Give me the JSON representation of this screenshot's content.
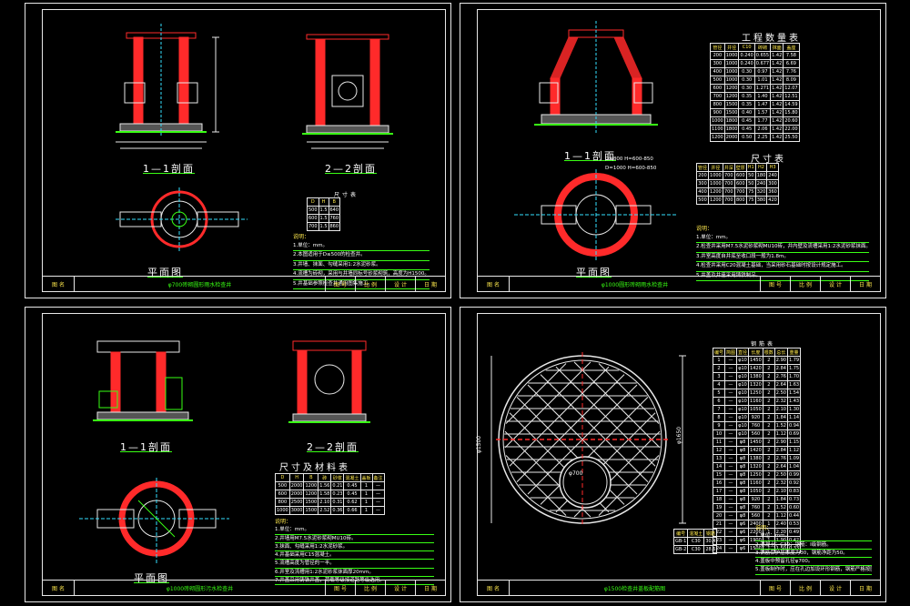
{
  "colors": {
    "background": "#000000",
    "line": "#e8e8e8",
    "red": "#ff2a2a",
    "green": "#39ff14",
    "yellow": "#ffe94d",
    "cyan": "#33e0ff"
  },
  "sheet1": {
    "section_a": "1—1剖面",
    "section_b": "2—2剖面",
    "plan": "平面图",
    "table_title": "尺寸表",
    "table_rows": [
      [
        "D",
        "H",
        "B"
      ],
      [
        "500",
        "1.5",
        "640"
      ],
      [
        "600",
        "1.5",
        "760"
      ],
      [
        "700",
        "1.5",
        "860"
      ]
    ],
    "notes": [
      "说明：",
      "1.单位：mm。",
      "2.本图适用于D≤500的检查井。",
      "3.井墙、抹面、勾缝采用1:2水泥砂浆。",
      "4.流槽为砖砌，采用与井墙同标号砂浆砌筑，高度为H1500。",
      "5.井基础参照检查井通用图集施工。"
    ],
    "title_block": [
      "图 名",
      "φ700砖砌圆形雨水检查井",
      "图 号",
      "比 例",
      "设 计",
      "日 期"
    ]
  },
  "sheet2": {
    "table1_title": "工程数量表",
    "table1_rows": [
      [
        "管径",
        "井径",
        "C10",
        "砖砌",
        "抹面",
        "盖座"
      ],
      [
        "200",
        "1000",
        "0.240",
        "0.655",
        "1.42",
        "7.58"
      ],
      [
        "300",
        "1000",
        "0.240",
        "0.677",
        "1.42",
        "6.69"
      ],
      [
        "400",
        "1000",
        "0.30",
        "0.97",
        "1.42",
        "7.76"
      ],
      [
        "500",
        "1000",
        "0.30",
        "1.01",
        "1.42",
        "8.09"
      ],
      [
        "600",
        "1200",
        "0.30",
        "1.271",
        "1.42",
        "12.07"
      ],
      [
        "700",
        "1200",
        "0.35",
        "1.40",
        "1.42",
        "12.51"
      ],
      [
        "800",
        "1500",
        "0.35",
        "1.47",
        "1.42",
        "14.59"
      ],
      [
        "900",
        "1500",
        "0.40",
        "1.57",
        "1.42",
        "15.80"
      ],
      [
        "1000",
        "1800",
        "0.45",
        "1.77",
        "1.42",
        "20.60"
      ],
      [
        "1100",
        "1800",
        "0.45",
        "2.06",
        "1.42",
        "22.00"
      ],
      [
        "1200",
        "2000",
        "0.50",
        "2.25",
        "1.42",
        "25.50"
      ]
    ],
    "table2_title": "尺寸表",
    "table2_rows": [
      [
        "管径",
        "井径",
        "井深",
        "壁厚",
        "H1",
        "H2",
        "H3"
      ],
      [
        "200",
        "1000",
        "700",
        "600",
        "50",
        "180",
        "240"
      ],
      [
        "300",
        "1000",
        "700",
        "600",
        "50",
        "240",
        "300"
      ],
      [
        "400",
        "1200",
        "700",
        "700",
        "75",
        "320",
        "360"
      ],
      [
        "500",
        "1200",
        "700",
        "800",
        "75",
        "380",
        "420"
      ]
    ],
    "section": "1—1剖面",
    "plan": "平面图",
    "note_right": [
      "D=800 H=600-850",
      "D=1000 H=600-850"
    ],
    "notes": [
      "说明：",
      "1.单位：mm。",
      "2.检查井采用M7.5水泥砂浆砌MU10砖，井内壁及流槽采用1:2水泥砂浆抹面。",
      "3.井室高度自井底至收口段一般为1.8m。",
      "4.检查井采用C20混凝土基础，当采用砂石基础时按设计规定施工。",
      "5.井盖及井座采用铸铁制品。"
    ],
    "title_block": [
      "图 名",
      "φ1000圆形砖砌雨水检查井",
      "图 号",
      "比 例",
      "设 计",
      "日 期"
    ]
  },
  "sheet3": {
    "section_a": "1—1剖面",
    "section_b": "2—2剖面",
    "plan": "平面图",
    "table_title": "尺寸及材料表",
    "table_rows": [
      [
        "D",
        "H",
        "B",
        "砖",
        "砂浆",
        "混凝土",
        "盖板",
        "备注"
      ],
      [
        "500",
        "2000",
        "1200",
        "1.56",
        "0.21",
        "0.45",
        "1",
        "—"
      ],
      [
        "600",
        "2000",
        "1200",
        "1.58",
        "0.23",
        "0.45",
        "1",
        "—"
      ],
      [
        "800",
        "2500",
        "1500",
        "2.10",
        "0.31",
        "0.62",
        "1",
        "—"
      ],
      [
        "1000",
        "3000",
        "1500",
        "2.52",
        "0.36",
        "0.66",
        "1",
        "—"
      ]
    ],
    "notes": [
      "说明：",
      "1.单位：mm。",
      "2.井墙用M7.5水泥砂浆砌MU10砖。",
      "3.抹面、勾缝采用1:2水泥砂浆。",
      "4.井基础采用C15混凝土。",
      "5.流槽高度为管径的一半。",
      "6.井室及流槽用1:2水泥砂浆抹面厚20mm。",
      "7.井盖采用铸铁井盖，荷载等级按道路等级选用。"
    ],
    "title_block": [
      "图 名",
      "φ1000砖砌圆形污水检查井",
      "图 号",
      "比 例",
      "设 计",
      "日 期"
    ]
  },
  "sheet4": {
    "dim_left": "φ1500",
    "dim_right": "φ1650",
    "dim_hole": "φ700",
    "table_title": "钢筋表",
    "table_header": [
      "编号",
      "简图",
      "直径",
      "长度",
      "根数",
      "总长",
      "重量"
    ],
    "table_rows": [
      [
        "1",
        "—",
        "φ10",
        "1450",
        "2",
        "2.90",
        "1.79"
      ],
      [
        "2",
        "—",
        "φ10",
        "1420",
        "2",
        "2.84",
        "1.75"
      ],
      [
        "3",
        "—",
        "φ10",
        "1380",
        "2",
        "2.76",
        "1.70"
      ],
      [
        "4",
        "—",
        "φ10",
        "1320",
        "2",
        "2.64",
        "1.63"
      ],
      [
        "5",
        "—",
        "φ10",
        "1250",
        "2",
        "2.50",
        "1.54"
      ],
      [
        "6",
        "—",
        "φ10",
        "1160",
        "2",
        "2.32",
        "1.43"
      ],
      [
        "7",
        "—",
        "φ10",
        "1050",
        "2",
        "2.10",
        "1.30"
      ],
      [
        "8",
        "—",
        "φ10",
        "920",
        "2",
        "1.84",
        "1.14"
      ],
      [
        "9",
        "—",
        "φ10",
        "760",
        "2",
        "1.52",
        "0.94"
      ],
      [
        "10",
        "—",
        "φ10",
        "560",
        "2",
        "1.12",
        "0.69"
      ],
      [
        "11",
        "—",
        "φ8",
        "1450",
        "2",
        "2.90",
        "1.15"
      ],
      [
        "12",
        "—",
        "φ8",
        "1420",
        "2",
        "2.84",
        "1.12"
      ],
      [
        "13",
        "—",
        "φ8",
        "1380",
        "2",
        "2.76",
        "1.09"
      ],
      [
        "14",
        "—",
        "φ8",
        "1320",
        "2",
        "2.64",
        "1.04"
      ],
      [
        "15",
        "—",
        "φ8",
        "1250",
        "2",
        "2.50",
        "0.99"
      ],
      [
        "16",
        "—",
        "φ8",
        "1160",
        "2",
        "2.32",
        "0.92"
      ],
      [
        "17",
        "—",
        "φ8",
        "1050",
        "2",
        "2.10",
        "0.83"
      ],
      [
        "18",
        "—",
        "φ8",
        "920",
        "2",
        "1.84",
        "0.73"
      ],
      [
        "19",
        "—",
        "φ8",
        "760",
        "2",
        "1.52",
        "0.60"
      ],
      [
        "20",
        "—",
        "φ8",
        "560",
        "2",
        "1.12",
        "0.44"
      ],
      [
        "21",
        "—",
        "φ6",
        "2400",
        "1",
        "2.40",
        "0.53"
      ],
      [
        "22",
        "—",
        "φ6",
        "2200",
        "1",
        "2.20",
        "0.49"
      ],
      [
        "23",
        "—",
        "φ6",
        "1900",
        "1",
        "1.90",
        "0.42"
      ],
      [
        "24",
        "—",
        "φ6",
        "1500",
        "1",
        "1.50",
        "0.33"
      ]
    ],
    "small_table": [
      [
        "编号",
        "混凝土",
        "钢筋"
      ],
      [
        "GB-1",
        "C30",
        "30.4"
      ],
      [
        "GB-2",
        "C30",
        "28.6"
      ]
    ],
    "notes": [
      "说明：",
      "1.单位：mm。",
      "2.混凝土：C30；钢筋：Ⅰ级钢筋。",
      "3.钢筋保护层厚度为30，钢筋净距为50。",
      "4.盖板中预留孔径φ700。",
      "5.盖板制作时，应在孔边加设环形钢筋，钢筋严格按图施工。"
    ],
    "title_block": [
      "图 名",
      "φ1500检查井盖板配筋图",
      "图 号",
      "比 例",
      "设 计",
      "日 期"
    ]
  }
}
